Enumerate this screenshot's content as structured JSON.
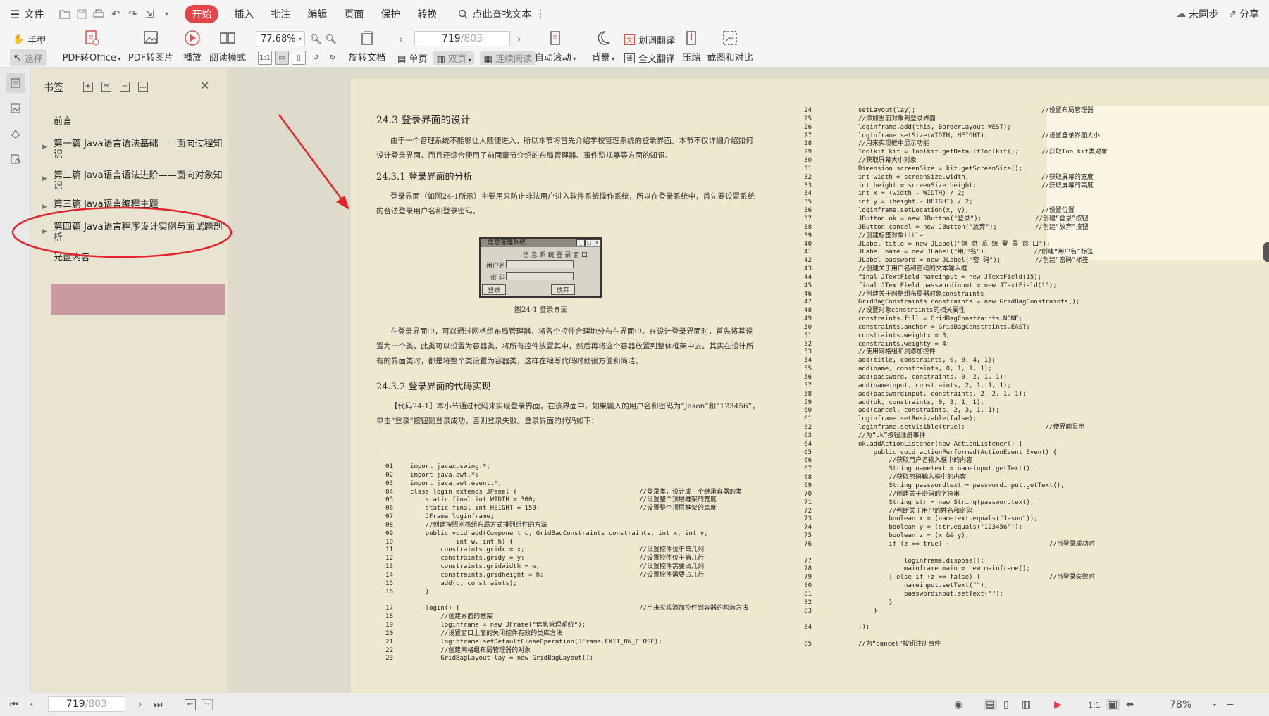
{
  "menubar": {
    "file": "文件",
    "tabs": [
      "开始",
      "插入",
      "批注",
      "编辑",
      "页面",
      "保护",
      "转换"
    ],
    "search_label": "点此查找文本",
    "sync": "未同步",
    "share": "分享"
  },
  "ribbon": {
    "hand": "手型",
    "select": "选择",
    "pdf_to_office": "PDF转Office",
    "pdf_to_image": "PDF转图片",
    "play": "播放",
    "read_mode": "阅读模式",
    "zoom_value": "77.68%",
    "rotate_doc": "旋转文档",
    "page_current": "719",
    "page_total": "/803",
    "single_page": "单页",
    "double_page": "双页",
    "continuous": "连续阅读",
    "auto_scroll": "自动滚动",
    "background": "背景",
    "word_translate": "划词翻译",
    "full_translate": "全文翻译",
    "compress": "压缩",
    "screenshot_compare": "截图和对比"
  },
  "bookmarks": {
    "title": "书签",
    "items": [
      {
        "label": "前言"
      },
      {
        "label": "第一篇  Java语言语法基础——面向过程知识"
      },
      {
        "label": "第二篇  Java语言语法进阶——面向对象知识"
      },
      {
        "label": "第三篇  Java语言编程主题"
      },
      {
        "label": "第四篇  Java语言程序设计实例与面试题剖析"
      },
      {
        "label": "光盘内容"
      }
    ]
  },
  "page_left": {
    "section_title": "24.3   登录界面的设计",
    "intro": "由于一个管理系统不能够让人随便进入，所以本节将首先介绍学校管理系统的登录界面。本节不仅详细介绍如何设计登录界面，而且还综合使用了前面章节介绍的布局管理器、事件监视器等方面的知识。",
    "sub1": "24.3.1   登录界面的分析",
    "sub1_text": "登录界面（如图24-1所示）主要用来防止非法用户进入软件系统操作系统，所以在登录系统中，首先要设置系统的合法登录用户名和登录密码。",
    "dialog_title": "信息管理系统",
    "dialog_heading": "信 息 系 统 登 录 窗 口",
    "dialog_user": "用户名",
    "dialog_pass": "密 码",
    "dialog_login": "登录",
    "dialog_cancel": "放弃",
    "dialog_btns": [
      "_",
      "□",
      "X"
    ],
    "fig_caption": "图24-1   登录界面",
    "para2": "在登录界面中，可以通过网格组布局管理器，将各个控件合理地分布在界面中。在设计登录界面时，首先将其设置为一个类，此类可以设置为容器类，将所有控件放置其中，然后再将这个容器放置到整体框架中去。其实在设计所有的界面类时，都是将整个类设置为容器类，这样在编写代码时就很方便和简洁。",
    "sub2": "24.3.2   登录界面的代码实现",
    "sub2_text": "【代码24-1】本小节通过代码来实现登录界面，在该界面中，如果输入的用户名和密码为“Jason”和“123456”，单击“登录”按钮则登录成功，否则登录失败。登录界面的代码如下：",
    "code_nums": "01\n02\n03\n04\n05\n06\n07\n08\n09\n10\n11\n12\n13\n14\n15\n16\n\n17\n18\n19\n20\n21\n22\n23",
    "code": "import javax.swing.*;\nimport java.awt.*;\nimport java.awt.event.*;\nclass login extends JPanel {                                //登录类，设计成一个继承容器的类\n    static final int WIDTH = 300;                           //设置整个顶层框架的宽度\n    static final int HEIGHT = 150;                          //设置整个顶层框架的高度\n    JFrame loginframe;\n    //创建按照网格组布局方式排列组件的方法\n    public void add(Component c, GridBagConstraints constraints, int x, int y,\n            int w, int h) {\n        constraints.gridx = x;                              //设置控件位于第几列\n        constraints.gridy = y;                              //设置控件位于第几行\n        constraints.gridwidth = w;                          //设置控件需要占几列\n        constraints.gridheight = h;                         //设置控件需要占几行\n        add(c, constraints);\n    }\n\n    login() {                                               //用来实现添加控件到容器的构造方法\n        //创建界面的框架\n        loginframe = new JFrame(\"信息管理系统\");\n        //设置窗口上面的关闭控件有效的类库方法\n        loginframe.setDefaultCloseOperation(JFrame.EXIT_ON_CLOSE);\n        //创建网格组布局管理器的对象\n        GridBagLayout lay = new GridBagLayout();"
  },
  "page_right": {
    "code_nums": "24\n25\n26\n27\n28\n29\n30\n31\n32\n33\n34\n35\n36\n37\n38\n39\n40\n41\n42\n43\n44\n45\n46\n47\n48\n49\n50\n51\n52\n53\n54\n55\n56\n57\n58\n59\n60\n61\n62\n63\n64\n65\n66\n67\n68\n69\n70\n71\n72\n73\n74\n75\n76\n\n77\n78\n79\n80\n81\n82\n83\n\n84\n\n85",
    "code": "setLayout(lay);                                 //设置布局管理器\n//添加当前对象到登录界面\nloginframe.add(this, BorderLayout.WEST);\nloginframe.setSize(WIDTH, HEIGHT);              //设置登录界面大小\n//用来实现框中显示功能\nToolkit kit = Toolkit.getDefaultToolkit();      //获取Toolkit类对象\n//获取屏幕大小对象\nDimension screenSize = kit.getScreenSize();\nint width = screenSize.width;                   //获取屏幕的宽度\nint height = screenSize.height;                 //获取屏幕的高度\nint x = (width - WIDTH) / 2;\nint y = (height - HEIGHT) / 2;\nloginframe.setLocation(x, y);                   //设置位置\nJButton ok = new JButton(\"登录\");              //创建“登录”按钮\nJButton cancel = new JButton(\"放弃\");          //创建“放弃”按钮\n//创建标签对象title\nJLabel title = new JLabel(\"信 息 系 统 登 录 窗 口\");\nJLabel name = new JLabel(\"用户名\");            //创建“用户名”标签\nJLabel password = new JLabel(\"密 码\");         //创建“密码”标签\n//创建关于用户名和密码的文本输入框\nfinal JTextField nameinput = new JTextField(15);\nfinal JTextField passwordinput = new JTextField(15);\n//创建关于网格组布局器对象constraints\nGridBagConstraints constraints = new GridBagConstraints();\n//设置对象constraints的相关属性\nconstraints.fill = GridBagConstraints.NONE;\nconstraints.anchor = GridBagConstraints.EAST;\nconstraints.weightx = 3;\nconstraints.weighty = 4;\n//使用网格组布局添加控件\nadd(title, constraints, 0, 0, 4, 1);\nadd(name, constraints, 0, 1, 1, 1);\nadd(password, constraints, 0, 2, 1, 1);\nadd(nameinput, constraints, 2, 1, 1, 1);\nadd(passwordinput, constraints, 2, 2, 1, 1);\nadd(ok, constraints, 0, 3, 1, 1);\nadd(cancel, constraints, 2, 3, 1, 1);\nloginframe.setResizable(false);\nloginframe.setVisible(true);                     //使界面显示\n//为“ok”按钮注册事件\nok.addActionListener(new ActionListener() {\n    public void actionPerformed(ActionEvent Event) {\n        //获取用户名输入框中的内容\n        String nametext = nameinput.getText();\n        //获取密码输入框中的内容\n        String passwordtext = passwordinput.getText();\n        //创建关于密码的字符串\n        String str = new String(passwordtext);\n        //判断关于用户的姓名和密码\n        boolean x = (nametext.equals(\"Jason\"));\n        boolean y = (str.equals(\"123456\"));\n        boolean z = (x && y);\n        if (z == true) {                          //当登录成功时\n\n            loginframe.dispose();\n            mainframe main = new mainframe();\n        } else if (z == false) {                  //当登录失败时\n            nameinput.setText(\"\");\n            passwordinput.setText(\"\");\n        }\n    }\n\n});\n\n//为“cancel”按钮注册事件"
  },
  "statusbar": {
    "page_current": "719",
    "page_total": "/803",
    "zoom": "78%"
  },
  "colors": {
    "accent": "#e4454a",
    "page_bg": "#efe7ce",
    "panel_bg": "#e9e4d2",
    "selected_bookmark": "#c99ba0",
    "annotation_red": "#e3242b"
  }
}
